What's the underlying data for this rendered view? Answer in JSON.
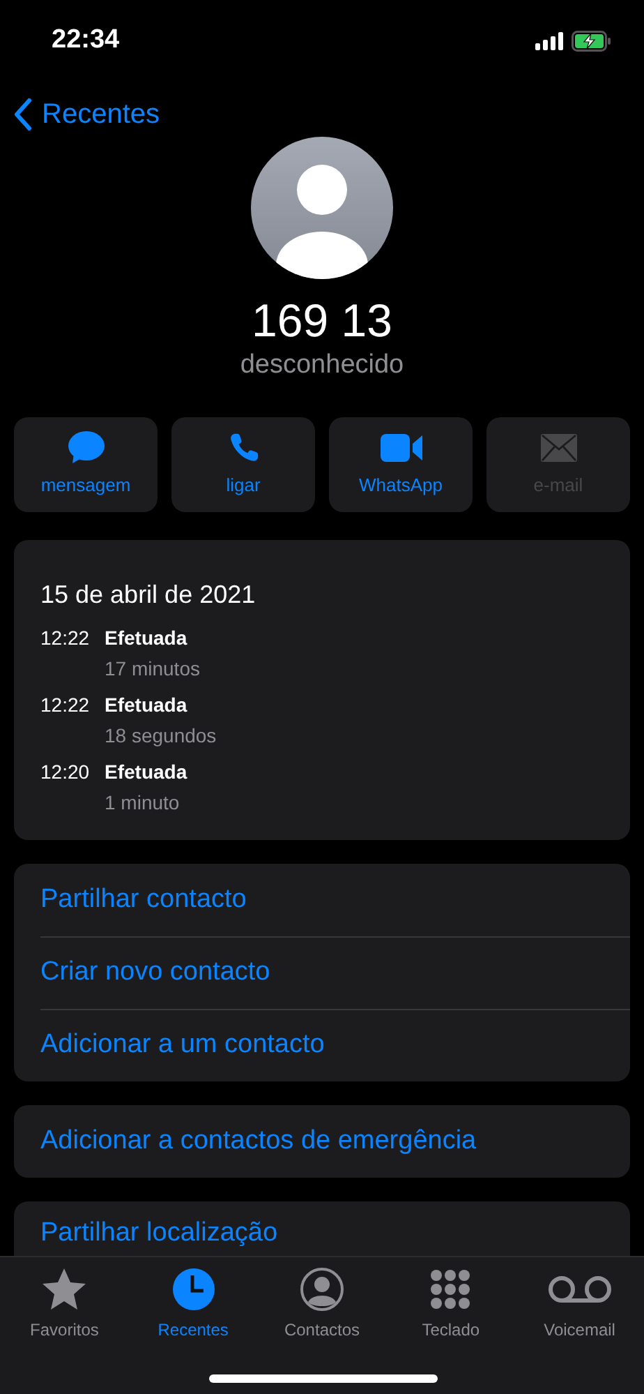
{
  "status_bar": {
    "time": "22:34"
  },
  "nav": {
    "back": "Recentes"
  },
  "contact": {
    "name": "169 13",
    "subtitle": "desconhecido"
  },
  "actions": [
    {
      "kind": "message",
      "label": "mensagem",
      "disabled": false
    },
    {
      "kind": "phone",
      "label": "ligar",
      "disabled": false
    },
    {
      "kind": "video",
      "label": "WhatsApp",
      "disabled": false
    },
    {
      "kind": "mail",
      "label": "e-mail",
      "disabled": true
    }
  ],
  "call_history": {
    "date": "15 de abril de 2021",
    "calls": [
      {
        "time": "12:22",
        "type": "Efetuada",
        "duration": "17 minutos"
      },
      {
        "time": "12:22",
        "type": "Efetuada",
        "duration": "18 segundos"
      },
      {
        "time": "12:20",
        "type": "Efetuada",
        "duration": "1 minuto"
      }
    ]
  },
  "option_groups": [
    [
      "Partilhar contacto",
      "Criar novo contacto",
      "Adicionar a um contacto"
    ],
    [
      "Adicionar a contactos de emergência"
    ],
    [
      "Partilhar localização"
    ]
  ],
  "tab_bar": [
    {
      "kind": "star",
      "label": "Favoritos",
      "selected": false
    },
    {
      "kind": "clock",
      "label": "Recentes",
      "selected": true
    },
    {
      "kind": "person",
      "label": "Contactos",
      "selected": false
    },
    {
      "kind": "keypad",
      "label": "Teclado",
      "selected": false
    },
    {
      "kind": "voicemail",
      "label": "Voicemail",
      "selected": false
    }
  ]
}
